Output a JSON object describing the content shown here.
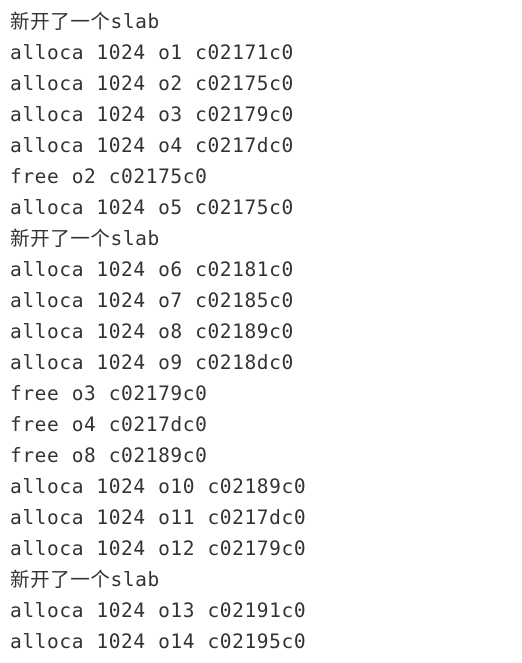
{
  "top_fragment": "y [",
  "lines": [
    "新开了一个slab",
    "alloca 1024 o1 c02171c0",
    "alloca 1024 o2 c02175c0",
    "alloca 1024 o3 c02179c0",
    "alloca 1024 o4 c0217dc0",
    "free o2 c02175c0",
    "alloca 1024 o5 c02175c0",
    "新开了一个slab",
    "alloca 1024 o6 c02181c0",
    "alloca 1024 o7 c02185c0",
    "alloca 1024 o8 c02189c0",
    "alloca 1024 o9 c0218dc0",
    "free o3 c02179c0",
    "free o4 c0217dc0",
    "free o8 c02189c0",
    "alloca 1024 o10 c02189c0",
    "alloca 1024 o11 c0217dc0",
    "alloca 1024 o12 c02179c0",
    "新开了一个slab",
    "alloca 1024 o13 c02191c0",
    "alloca 1024 o14 c02195c0"
  ]
}
